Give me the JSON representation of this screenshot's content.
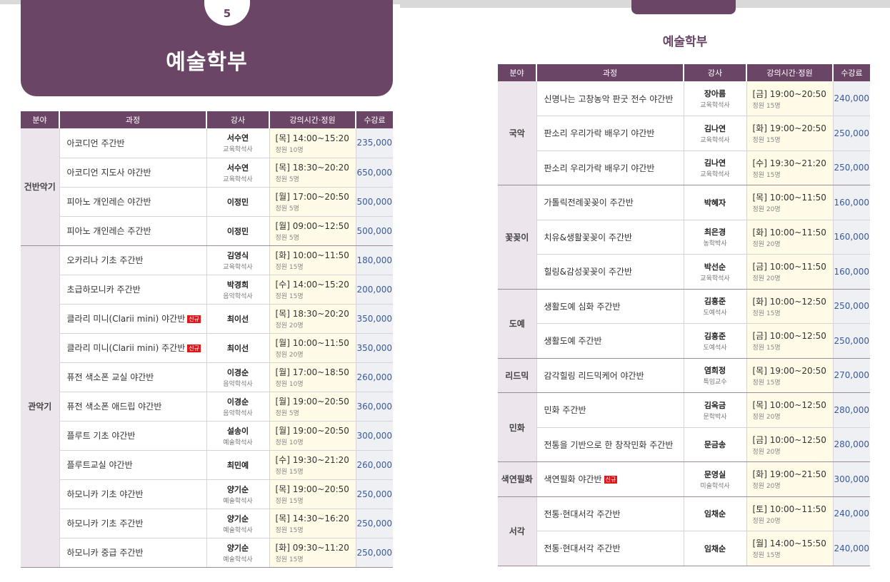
{
  "left_page": {
    "page_number": "5",
    "title": "예술학부",
    "headers": [
      "분야",
      "과정",
      "강사",
      "강의시간·정원",
      "수강료"
    ],
    "groups": [
      {
        "category": "건반악기",
        "rows": [
          {
            "course": "아코디언 주간반",
            "badge": "",
            "instructor": "서수연",
            "inst_title": "교육학석사",
            "time": "[목] 14:00~15:20",
            "capacity": "정원 10명",
            "fee": "235,000"
          },
          {
            "course": "아코디언 지도사 야간반",
            "badge": "",
            "instructor": "서수연",
            "inst_title": "교육학석사",
            "time": "[목] 18:30~20:20",
            "capacity": "정원 5명",
            "fee": "650,000"
          },
          {
            "course": "피아노 개인레슨 야간반",
            "badge": "",
            "instructor": "이정민",
            "inst_title": "",
            "time": "[월] 17:00~20:50",
            "capacity": "정원 5명",
            "fee": "500,000"
          },
          {
            "course": "피아노 개인레슨 주간반",
            "badge": "",
            "instructor": "이정민",
            "inst_title": "",
            "time": "[월] 09:00~12:50",
            "capacity": "정원 5명",
            "fee": "500,000"
          }
        ]
      },
      {
        "category": "관악기",
        "rows": [
          {
            "course": "오카리나 기초 주간반",
            "badge": "",
            "instructor": "김영식",
            "inst_title": "교육학석사",
            "time": "[화] 10:00~11:50",
            "capacity": "정원 15명",
            "fee": "180,000"
          },
          {
            "course": "초급하모니카 주간반",
            "badge": "",
            "instructor": "박경희",
            "inst_title": "음악학석사",
            "time": "[수] 14:00~15:20",
            "capacity": "정원 15명",
            "fee": "200,000"
          },
          {
            "course": "클라리 미니(Clarii mini) 야간반",
            "badge": "신규",
            "instructor": "최이선",
            "inst_title": "",
            "time": "[목] 18:30~20:20",
            "capacity": "정원 20명",
            "fee": "350,000"
          },
          {
            "course": "클라리 미니(Clarii mini) 주간반",
            "badge": "신규",
            "instructor": "최이선",
            "inst_title": "",
            "time": "[월] 10:00~11:50",
            "capacity": "정원 20명",
            "fee": "350,000"
          },
          {
            "course": "퓨전 색소폰 교실 야간반",
            "badge": "",
            "instructor": "이경순",
            "inst_title": "음악학석사",
            "time": "[월] 17:00~18:50",
            "capacity": "정원 10명",
            "fee": "260,000"
          },
          {
            "course": "퓨전 색소폰 애드립 야간반",
            "badge": "",
            "instructor": "이경순",
            "inst_title": "음악학석사",
            "time": "[월] 19:00~20:50",
            "capacity": "정원 5명",
            "fee": "360,000"
          },
          {
            "course": "플루트 기초 야간반",
            "badge": "",
            "instructor": "설송이",
            "inst_title": "예술학석사",
            "time": "[월] 19:00~20:50",
            "capacity": "정원 10명",
            "fee": "300,000"
          },
          {
            "course": "플루트교실 야간반",
            "badge": "",
            "instructor": "최민예",
            "inst_title": "",
            "time": "[수] 19:30~21:20",
            "capacity": "정원 15명",
            "fee": "260,000"
          },
          {
            "course": "하모니카 기초 야간반",
            "badge": "",
            "instructor": "양기순",
            "inst_title": "예술학석사",
            "time": "[목] 19:00~20:50",
            "capacity": "정원 15명",
            "fee": "250,000"
          },
          {
            "course": "하모니카 기초 주간반",
            "badge": "",
            "instructor": "양기순",
            "inst_title": "예술학석사",
            "time": "[목] 14:30~16:20",
            "capacity": "정원 15명",
            "fee": "250,000"
          },
          {
            "course": "하모니카 중급 주간반",
            "badge": "",
            "instructor": "양기순",
            "inst_title": "예술학석사",
            "time": "[화] 09:30~11:20",
            "capacity": "정원 15명",
            "fee": "250,000"
          }
        ]
      }
    ]
  },
  "right_page": {
    "title": "예술학부",
    "headers": [
      "분야",
      "과정",
      "강사",
      "강의시간·정원",
      "수강료"
    ],
    "groups": [
      {
        "category": "국악",
        "rows": [
          {
            "course": "신명나는 고창농악 판굿 전수 야간반",
            "badge": "",
            "instructor": "장아름",
            "inst_title": "교육학석사",
            "time": "[금] 19:00~20:50",
            "capacity": "정원 15명",
            "fee": "240,000"
          },
          {
            "course": "판소리 우리가락 배우기 야간반",
            "badge": "",
            "instructor": "김나연",
            "inst_title": "교육학석사",
            "time": "[화] 19:00~20:50",
            "capacity": "정원 15명",
            "fee": "250,000"
          },
          {
            "course": "판소리 우리가락 배우기 야간반",
            "badge": "",
            "instructor": "김나연",
            "inst_title": "교육학석사",
            "time": "[수] 19:30~21:20",
            "capacity": "정원 15명",
            "fee": "250,000"
          }
        ]
      },
      {
        "category": "꽃꽂이",
        "rows": [
          {
            "course": "가톨릭전례꽃꽂이 주간반",
            "badge": "",
            "instructor": "박혜자",
            "inst_title": "",
            "time": "[목] 10:00~11:50",
            "capacity": "정원 20명",
            "fee": "160,000"
          },
          {
            "course": "치유&생활꽃꽂이 주간반",
            "badge": "",
            "instructor": "최은경",
            "inst_title": "농학박사",
            "time": "[화] 10:00~11:50",
            "capacity": "정원 20명",
            "fee": "160,000"
          },
          {
            "course": "힐링&감성꽃꽂이 주간반",
            "badge": "",
            "instructor": "박선순",
            "inst_title": "교육학석사",
            "time": "[금] 10:00~11:50",
            "capacity": "정원 20명",
            "fee": "160,000"
          }
        ]
      },
      {
        "category": "도예",
        "rows": [
          {
            "course": "생활도예 심화 주간반",
            "badge": "",
            "instructor": "김흥준",
            "inst_title": "도예석사",
            "time": "[화] 10:00~12:50",
            "capacity": "정원 15명",
            "fee": "250,000"
          },
          {
            "course": "생활도예 주간반",
            "badge": "",
            "instructor": "김흥준",
            "inst_title": "도예석사",
            "time": "[금] 10:00~12:50",
            "capacity": "정원 15명",
            "fee": "250,000"
          }
        ]
      },
      {
        "category": "리드믹",
        "rows": [
          {
            "course": "감각힐링 리드믹케어 야간반",
            "badge": "",
            "instructor": "염희정",
            "inst_title": "특임교수",
            "time": "[목] 19:00~20:50",
            "capacity": "정원 15명",
            "fee": "270,000"
          }
        ]
      },
      {
        "category": "민화",
        "rows": [
          {
            "course": "민화 주간반",
            "badge": "",
            "instructor": "김옥금",
            "inst_title": "문학박사",
            "time": "[목] 10:00~12:50",
            "capacity": "정원 20명",
            "fee": "280,000"
          },
          {
            "course": "전통을 기반으로 한 창작민화 주간반",
            "badge": "",
            "instructor": "문금송",
            "inst_title": "",
            "time": "[금] 10:00~12:50",
            "capacity": "정원 20명",
            "fee": "280,000"
          }
        ]
      },
      {
        "category": "색연필화",
        "rows": [
          {
            "course": "색연필화 야간반",
            "badge": "신규",
            "instructor": "문영실",
            "inst_title": "미술학석사",
            "time": "[화] 19:00~21:50",
            "capacity": "정원 20명",
            "fee": "300,000"
          }
        ]
      },
      {
        "category": "서각",
        "rows": [
          {
            "course": "전통·현대서각 주간반",
            "badge": "",
            "instructor": "임채순",
            "inst_title": "",
            "time": "[토] 10:00~11:50",
            "capacity": "정원 20명",
            "fee": "240,000"
          },
          {
            "course": "전통·현대서각 주간반",
            "badge": "",
            "instructor": "임채순",
            "inst_title": "",
            "time": "[월] 14:00~15:50",
            "capacity": "정원 15명",
            "fee": "240,000"
          }
        ]
      }
    ]
  }
}
